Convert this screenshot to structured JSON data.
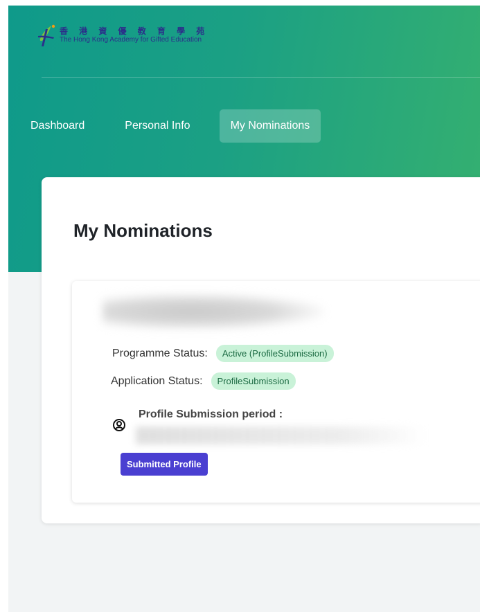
{
  "header": {
    "logo_chinese": "香 港 資 優 教 育 學 苑",
    "logo_english": "The Hong Kong Academy for Gifted Education"
  },
  "nav": {
    "items": [
      {
        "label": "Dashboard"
      },
      {
        "label": "Personal Info"
      },
      {
        "label": "My Nominations"
      }
    ],
    "active": "My Nominations"
  },
  "main": {
    "title": "My Nominations",
    "nomination": {
      "programme_status_label": "Programme Status:",
      "programme_status_value": "Active (ProfileSubmission)",
      "application_status_label": "Application Status:",
      "application_status_value": "ProfileSubmission",
      "period_label": "Profile Submission period :",
      "button_label": "Submitted Profile"
    }
  },
  "colors": {
    "header_gradient_start": "#0f9a8a",
    "header_gradient_end": "#35b070",
    "badge_bg": "#c9f2d8",
    "badge_text": "#1c6b43",
    "button_bg": "#4a3fd1"
  },
  "icons": {
    "logo": "academy-logo-icon",
    "period": "user-circle-icon"
  }
}
